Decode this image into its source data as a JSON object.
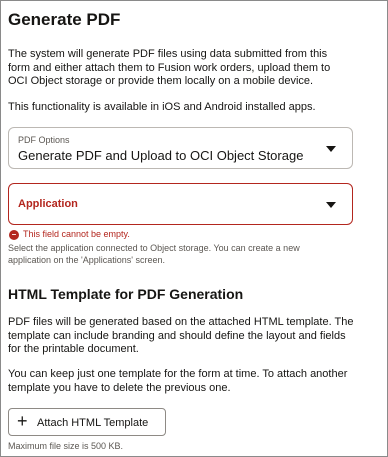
{
  "title": "Generate PDF",
  "intro": {
    "line1": "The system will generate PDF files using data submitted from this",
    "line2": "form and either attach them to Fusion work orders, upload them to",
    "line3": "OCI Object storage or provide them locally on a mobile device.",
    "availability": "This functionality is available in iOS and Android installed apps."
  },
  "pdf_options": {
    "label": "PDF Options",
    "value": "Generate PDF and Upload to OCI Object Storage"
  },
  "application": {
    "label": "Application",
    "error": "This field cannot be empty.",
    "help_line1": "Select the application connected to Object storage. You can create a new",
    "help_line2": "application on the 'Applications' screen."
  },
  "template_section": {
    "heading": "HTML Template for PDF Generation",
    "desc_line1": "PDF files will be generated based on the attached HTML template. The",
    "desc_line2": "template can include branding and should define the layout and fields",
    "desc_line3": "for the printable document.",
    "note_line1": "You can keep just one template for the form at time. To attach another",
    "note_line2": "template you have to delete the previous one.",
    "attach_button": "Attach HTML Template",
    "plus_icon": "+",
    "max_size": "Maximum file size is 500 KB."
  },
  "colors": {
    "error": "#b3261e",
    "border": "#bcb8b3",
    "text": "#161513"
  }
}
